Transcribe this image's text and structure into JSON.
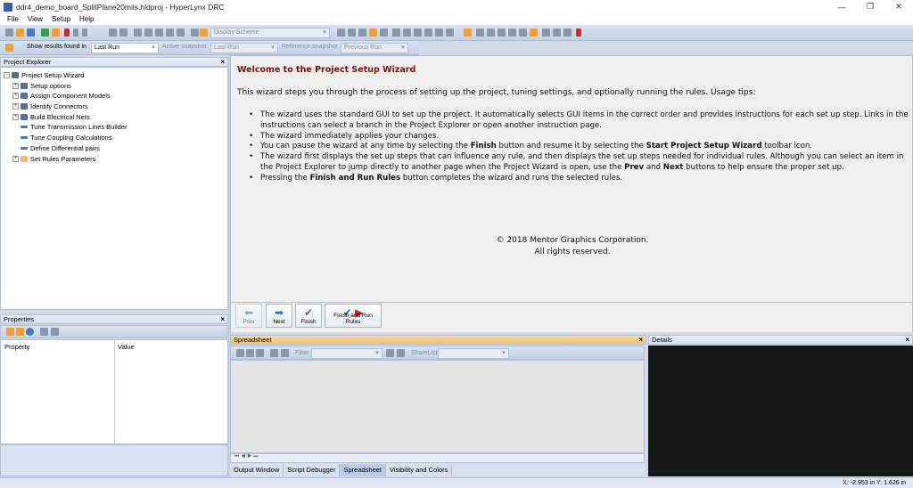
{
  "window": {
    "title": "ddr4_demo_board_SplitPlane20mils.hldproj - HyperLynx DRC",
    "controls": {
      "minimize": "—",
      "restore": "❐",
      "close": "✕"
    }
  },
  "menu": {
    "file": "File",
    "view": "View",
    "setup": "Setup",
    "help": "Help"
  },
  "toolbar": {
    "display_scheme_placeholder": "Display Scheme"
  },
  "results_bar": {
    "show_results_label": "Show results found in",
    "show_results_value": "Last Run",
    "active_snapshot_label": "Active snapshot",
    "active_snapshot_value": "Last Run",
    "reference_snapshot_label": "Reference snapshot",
    "reference_snapshot_value": "Previous Run"
  },
  "project_explorer": {
    "header": "Project Explorer",
    "root": "Project Setup Wizard",
    "items": [
      {
        "label": "Setup options"
      },
      {
        "label": "Assign Component Models"
      },
      {
        "label": "Identify Connectors"
      },
      {
        "label": "Build Electrical Nets"
      },
      {
        "label": "Tune Transmission Lines Builder"
      },
      {
        "label": "Tune Coupling Calculations"
      },
      {
        "label": "Define Differential pairs"
      },
      {
        "label": "Set Rules Parameters"
      }
    ]
  },
  "properties": {
    "header": "Properties",
    "col_property": "Property",
    "col_value": "Value"
  },
  "wizard": {
    "title": "Welcome to the Project Setup Wizard",
    "intro": "This wizard steps you through the process of setting up the project, tuning settings, and optionally running the rules. Usage tips:",
    "tip1": "The wizard uses the standard GUI to set up the project. It automatically selects GUI items in the correct order and provides instructions for each set up step. Links in the instructions can select a branch in the Project Explorer or open another instruction page.",
    "tip2": "The wizard immediately applies your changes.",
    "tip3_a": "You can pause the wizard at any time by selecting the ",
    "tip3_b": "Finish",
    "tip3_c": " button and resume it by selecting the ",
    "tip3_d": "Start Project Setup Wizard",
    "tip3_e": " toolbar icon.",
    "tip4_a": "The wizard first displays the set up steps that can influence any rule, and then displays the set up steps needed for individual rules. Although you can select an item in the Project Explorer to jump directly to another page when the Project Wizard is open, use the ",
    "tip4_b": "Prev",
    "tip4_c": " and ",
    "tip4_d": "Next",
    "tip4_e": " buttons to help ensure the proper set up.",
    "tip5_a": "Pressing the ",
    "tip5_b": "Finish and Run Rules",
    "tip5_c": " button completes the wizard and runs the selected rules.",
    "copyright": "© 2018 Mentor Graphics Corporation.",
    "rights": "All rights reserved.",
    "buttons": {
      "prev": "Prev",
      "next": "Next",
      "finish": "Finish",
      "finish_run": "Finish and Run Rules"
    }
  },
  "spreadsheet": {
    "header": "Spreadsheet",
    "filter_label": "Filter",
    "sharelist_label": "ShareList",
    "nav": "⏮ ◀ ▶ ⏭"
  },
  "bottom_tabs": [
    "Output Window",
    "Script Debugger",
    "Spreadsheet",
    "Visibility and Colors"
  ],
  "details": {
    "header": "Details"
  },
  "status": {
    "coords": "X: -2.953 in   Y: 1.626 in"
  },
  "colors": {
    "accent_title": "#7a1010",
    "panel_active": "#f0c070",
    "toolbar": "#c3d1e8"
  }
}
